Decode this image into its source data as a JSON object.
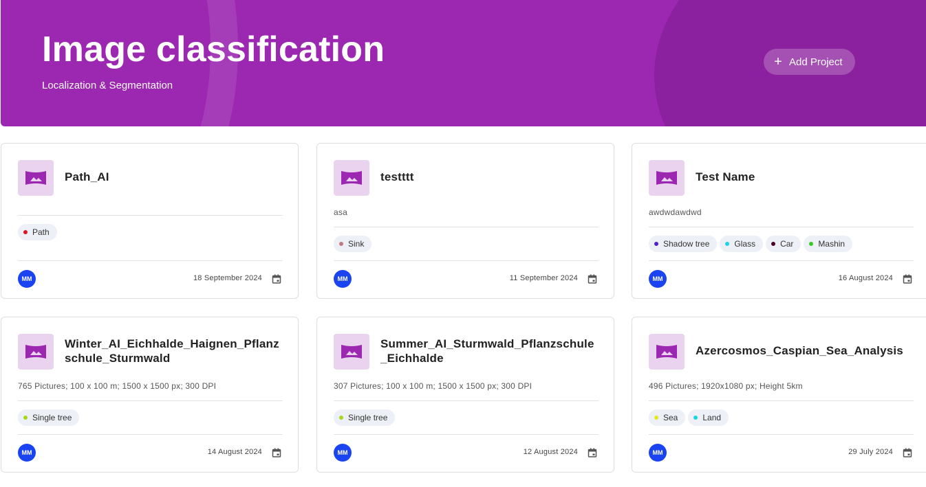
{
  "header": {
    "title": "Image classification",
    "subtitle": "Localization & Segmentation",
    "add_button_label": "Add Project",
    "add_button_icon": "plus-icon",
    "background_color": "#9c27b0"
  },
  "projects": [
    {
      "title": "Path_AI",
      "description": "",
      "tags": [
        {
          "label": "Path",
          "color": "#e0141e"
        }
      ],
      "owner_initials": "MM",
      "date": "18 September 2024"
    },
    {
      "title": "testttt",
      "description": "asa",
      "tags": [
        {
          "label": "Sink",
          "color": "#c27a82"
        }
      ],
      "owner_initials": "MM",
      "date": "11 September 2024"
    },
    {
      "title": "Test Name",
      "description": "awdwdawdwd",
      "tags": [
        {
          "label": "Shadow tree",
          "color": "#4a22c8"
        },
        {
          "label": "Glass",
          "color": "#1ed3e6"
        },
        {
          "label": "Car",
          "color": "#4b0328"
        },
        {
          "label": "Mashin",
          "color": "#3ac828"
        }
      ],
      "owner_initials": "MM",
      "date": "16 August 2024"
    },
    {
      "title": "Winter_AI_Eichhalde_Haignen_Pflanzschule_Sturmwald",
      "description": "765 Pictures; 100 x 100 m; 1500 x 1500 px; 300 DPI",
      "tags": [
        {
          "label": "Single tree",
          "color": "#a6d81a"
        }
      ],
      "owner_initials": "MM",
      "date": "14 August 2024"
    },
    {
      "title": "Summer_AI_Sturmwald_Pflanzschule_Eichhalde",
      "description": "307 Pictures; 100 x 100 m; 1500 x 1500 px; 300 DPI",
      "tags": [
        {
          "label": "Single tree",
          "color": "#a6d81a"
        }
      ],
      "owner_initials": "MM",
      "date": "12 August 2024"
    },
    {
      "title": "Azercosmos_Caspian_Sea_Analysis",
      "description": "496 Pictures; 1920x1080 px; Height 5km",
      "tags": [
        {
          "label": "Sea",
          "color": "#e6e61a"
        },
        {
          "label": "Land",
          "color": "#1ad6e0"
        }
      ],
      "owner_initials": "MM",
      "date": "29 July 2024"
    }
  ]
}
